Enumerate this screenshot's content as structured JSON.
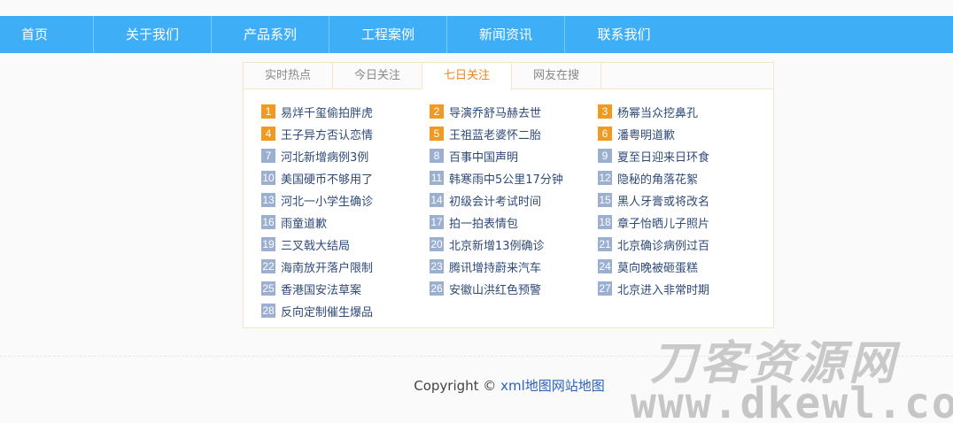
{
  "nav": [
    "首页",
    "关于我们",
    "产品系列",
    "工程案例",
    "新闻资讯",
    "联系我们"
  ],
  "tabs": [
    "实时热点",
    "今日关注",
    "七日关注",
    "网友在搜"
  ],
  "active_tab": "七日关注",
  "hot_list": [
    "易烊千玺偷拍胖虎",
    "导演乔舒马赫去世",
    "杨幂当众挖鼻孔",
    "王子异方否认恋情",
    "王祖蓝老婆怀二胎",
    "潘粤明道歉",
    "河北新增病例3例",
    "百事中国声明",
    "夏至日迎来日环食",
    "美国硬币不够用了",
    "韩寒雨中5公里17分钟",
    "隐秘的角落花絮",
    "河北一小学生确诊",
    "初级会计考试时间",
    "黑人牙膏或将改名",
    "雨童道歉",
    "拍一拍表情包",
    "章子怡晒儿子照片",
    "三叉戟大结局",
    "北京新增13例确诊",
    "北京确诊病例过百",
    "海南放开落户限制",
    "腾讯增持蔚来汽车",
    "莫向晚被砸蛋糕",
    "香港国安法草案",
    "安徽山洪红色预警",
    "北京进入非常时期",
    "反向定制催生爆品"
  ],
  "colors": {
    "nav_bg": "#3eaef7",
    "top_rank": "#f19a1f",
    "rank": "#9bb0d0",
    "active_tab": "#e8861f"
  },
  "footer": {
    "copyright": "Copyright ©",
    "link1": "xml地图",
    "link2": "网站地图"
  },
  "watermark": {
    "line1": "刀客资源网",
    "line2": "www.dkewl.com"
  }
}
